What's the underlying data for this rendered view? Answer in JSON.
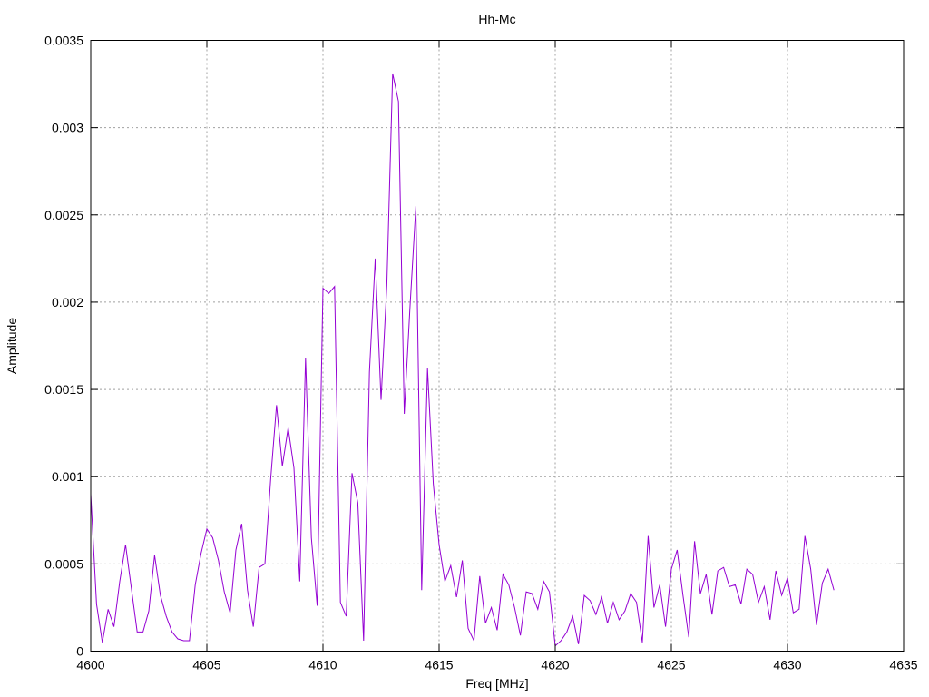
{
  "chart_data": {
    "type": "line",
    "title": "Hh-Mc",
    "xlabel": "Freq [MHz]",
    "ylabel": "Amplitude",
    "xlim": [
      4600,
      4635
    ],
    "ylim": [
      0,
      0.0035
    ],
    "x_ticks": [
      "4600",
      "4605",
      "4610",
      "4615",
      "4620",
      "4625",
      "4630",
      "4635"
    ],
    "y_ticks": [
      "0",
      "0.0005",
      "0.001",
      "0.0015",
      "0.002",
      "0.0025",
      "0.003",
      "0.0035"
    ],
    "grid": true,
    "line_color": "#9400d3",
    "series": [
      {
        "x": [
          4600.0,
          4600.25,
          4600.5,
          4600.75,
          4601.0,
          4601.25,
          4601.5,
          4601.75,
          4602.0,
          4602.25,
          4602.5,
          4602.75,
          4603.0,
          4603.25,
          4603.5,
          4603.75,
          4604.0,
          4604.25,
          4604.5,
          4604.75,
          4605.0,
          4605.25,
          4605.5,
          4605.75,
          4606.0,
          4606.25,
          4606.5,
          4606.75,
          4607.0,
          4607.25,
          4607.5,
          4607.75,
          4608.0,
          4608.25,
          4608.5,
          4608.75,
          4609.0,
          4609.25,
          4609.5,
          4609.75,
          4610.0,
          4610.25,
          4610.5,
          4610.75,
          4611.0,
          4611.25,
          4611.5,
          4611.75,
          4612.0,
          4612.25,
          4612.5,
          4612.75,
          4613.0,
          4613.25,
          4613.5,
          4613.75,
          4614.0,
          4614.25,
          4614.5,
          4614.75,
          4615.0,
          4615.25,
          4615.5,
          4615.75,
          4616.0,
          4616.25,
          4616.5,
          4616.75,
          4617.0,
          4617.25,
          4617.5,
          4617.75,
          4618.0,
          4618.25,
          4618.5,
          4618.75,
          4619.0,
          4619.25,
          4619.5,
          4619.75,
          4620.0,
          4620.25,
          4620.5,
          4620.75,
          4621.0,
          4621.25,
          4621.5,
          4621.75,
          4622.0,
          4622.25,
          4622.5,
          4622.75,
          4623.0,
          4623.25,
          4623.5,
          4623.75,
          4624.0,
          4624.25,
          4624.5,
          4624.75,
          4625.0,
          4625.25,
          4625.5,
          4625.75,
          4626.0,
          4626.25,
          4626.5,
          4626.75,
          4627.0,
          4627.25,
          4627.5,
          4627.75,
          4628.0,
          4628.25,
          4628.5,
          4628.75,
          4629.0,
          4629.25,
          4629.5,
          4629.75,
          4630.0,
          4630.25,
          4630.5,
          4630.75,
          4631.0,
          4631.25,
          4631.5,
          4631.75,
          4632.0
        ],
        "values": [
          0.0009,
          0.00027,
          5e-05,
          0.00024,
          0.00014,
          0.0004,
          0.00061,
          0.00036,
          0.00011,
          0.00011,
          0.00023,
          0.00055,
          0.00032,
          0.0002,
          0.00011,
          7e-05,
          6e-05,
          6e-05,
          0.00038,
          0.00056,
          0.0007,
          0.00065,
          0.00052,
          0.00034,
          0.00022,
          0.00058,
          0.00073,
          0.00035,
          0.00014,
          0.00048,
          0.0005,
          0.00099,
          0.00141,
          0.00106,
          0.00128,
          0.00105,
          0.0004,
          0.00168,
          0.00065,
          0.00026,
          0.00208,
          0.00205,
          0.00209,
          0.00028,
          0.0002,
          0.00102,
          0.00085,
          6e-05,
          0.0016,
          0.00225,
          0.00144,
          0.0021,
          0.00331,
          0.00315,
          0.00136,
          0.00198,
          0.00255,
          0.00035,
          0.00162,
          0.00096,
          0.00061,
          0.0004,
          0.00049,
          0.00031,
          0.00052,
          0.00013,
          6e-05,
          0.00043,
          0.00016,
          0.00025,
          0.00012,
          0.00044,
          0.00038,
          0.00025,
          9e-05,
          0.00034,
          0.00033,
          0.00024,
          0.0004,
          0.00034,
          3e-05,
          6e-05,
          0.00011,
          0.0002,
          4e-05,
          0.00032,
          0.00029,
          0.00021,
          0.00031,
          0.00016,
          0.00028,
          0.00018,
          0.00023,
          0.00033,
          0.00028,
          5e-05,
          0.00066,
          0.00025,
          0.00038,
          0.00014,
          0.00047,
          0.00058,
          0.00032,
          8e-05,
          0.00063,
          0.00033,
          0.00044,
          0.00021,
          0.00046,
          0.00048,
          0.00037,
          0.00038,
          0.00027,
          0.00047,
          0.00044,
          0.00028,
          0.00037,
          0.00018,
          0.00046,
          0.00032,
          0.00042,
          0.00022,
          0.00024,
          0.00066,
          0.00047,
          0.00015,
          0.00039,
          0.00047,
          0.00035
        ]
      }
    ]
  }
}
